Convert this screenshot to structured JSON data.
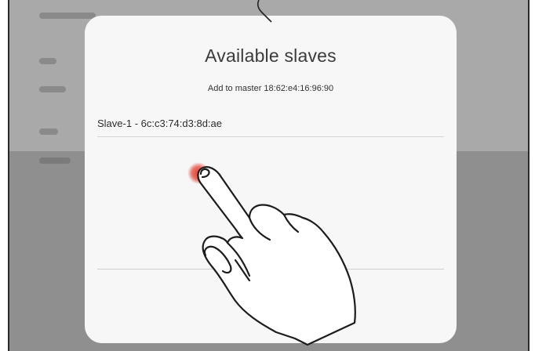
{
  "dialog": {
    "title": "Available slaves",
    "subtitle": "Add to master 18:62:e4:16:96:90",
    "slaves": [
      {
        "label": "Slave-1 - 6c:c3:74:d3:8d:ae"
      }
    ]
  },
  "overlay": {
    "gesture": "tap",
    "hand_icon": "pointing-hand-icon",
    "touch_color": "#e53b2c"
  },
  "colors": {
    "scrim": "#8f8f8f",
    "dialog_bg": "#f7f7f7",
    "title_text": "#3b3b3b"
  }
}
